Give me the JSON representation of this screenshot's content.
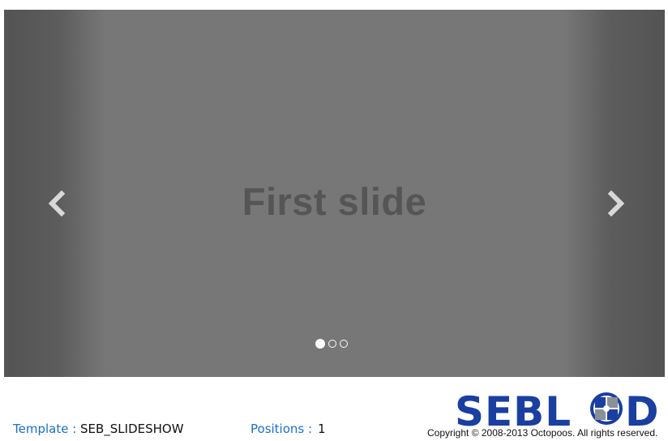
{
  "slideshow": {
    "slide_text": "First slide",
    "prev_icon": "chevron-left-icon",
    "next_icon": "chevron-right-icon",
    "indicator_count": 3,
    "active_indicator": 1
  },
  "footer": {
    "template_label": "Template :",
    "template_value": "SEB_SLIDESHOW",
    "positions_label": "Positions :",
    "positions_value": "1",
    "logo_text": "SEBLOD",
    "copyright": "Copyright © 2008-2013 Octopoos. All rights reserved."
  },
  "colors": {
    "slide_bg": "#777777",
    "label_blue": "#1a6fc8",
    "logo_blue": "#1a3fa0",
    "logo_gray": "#8a8f99"
  }
}
